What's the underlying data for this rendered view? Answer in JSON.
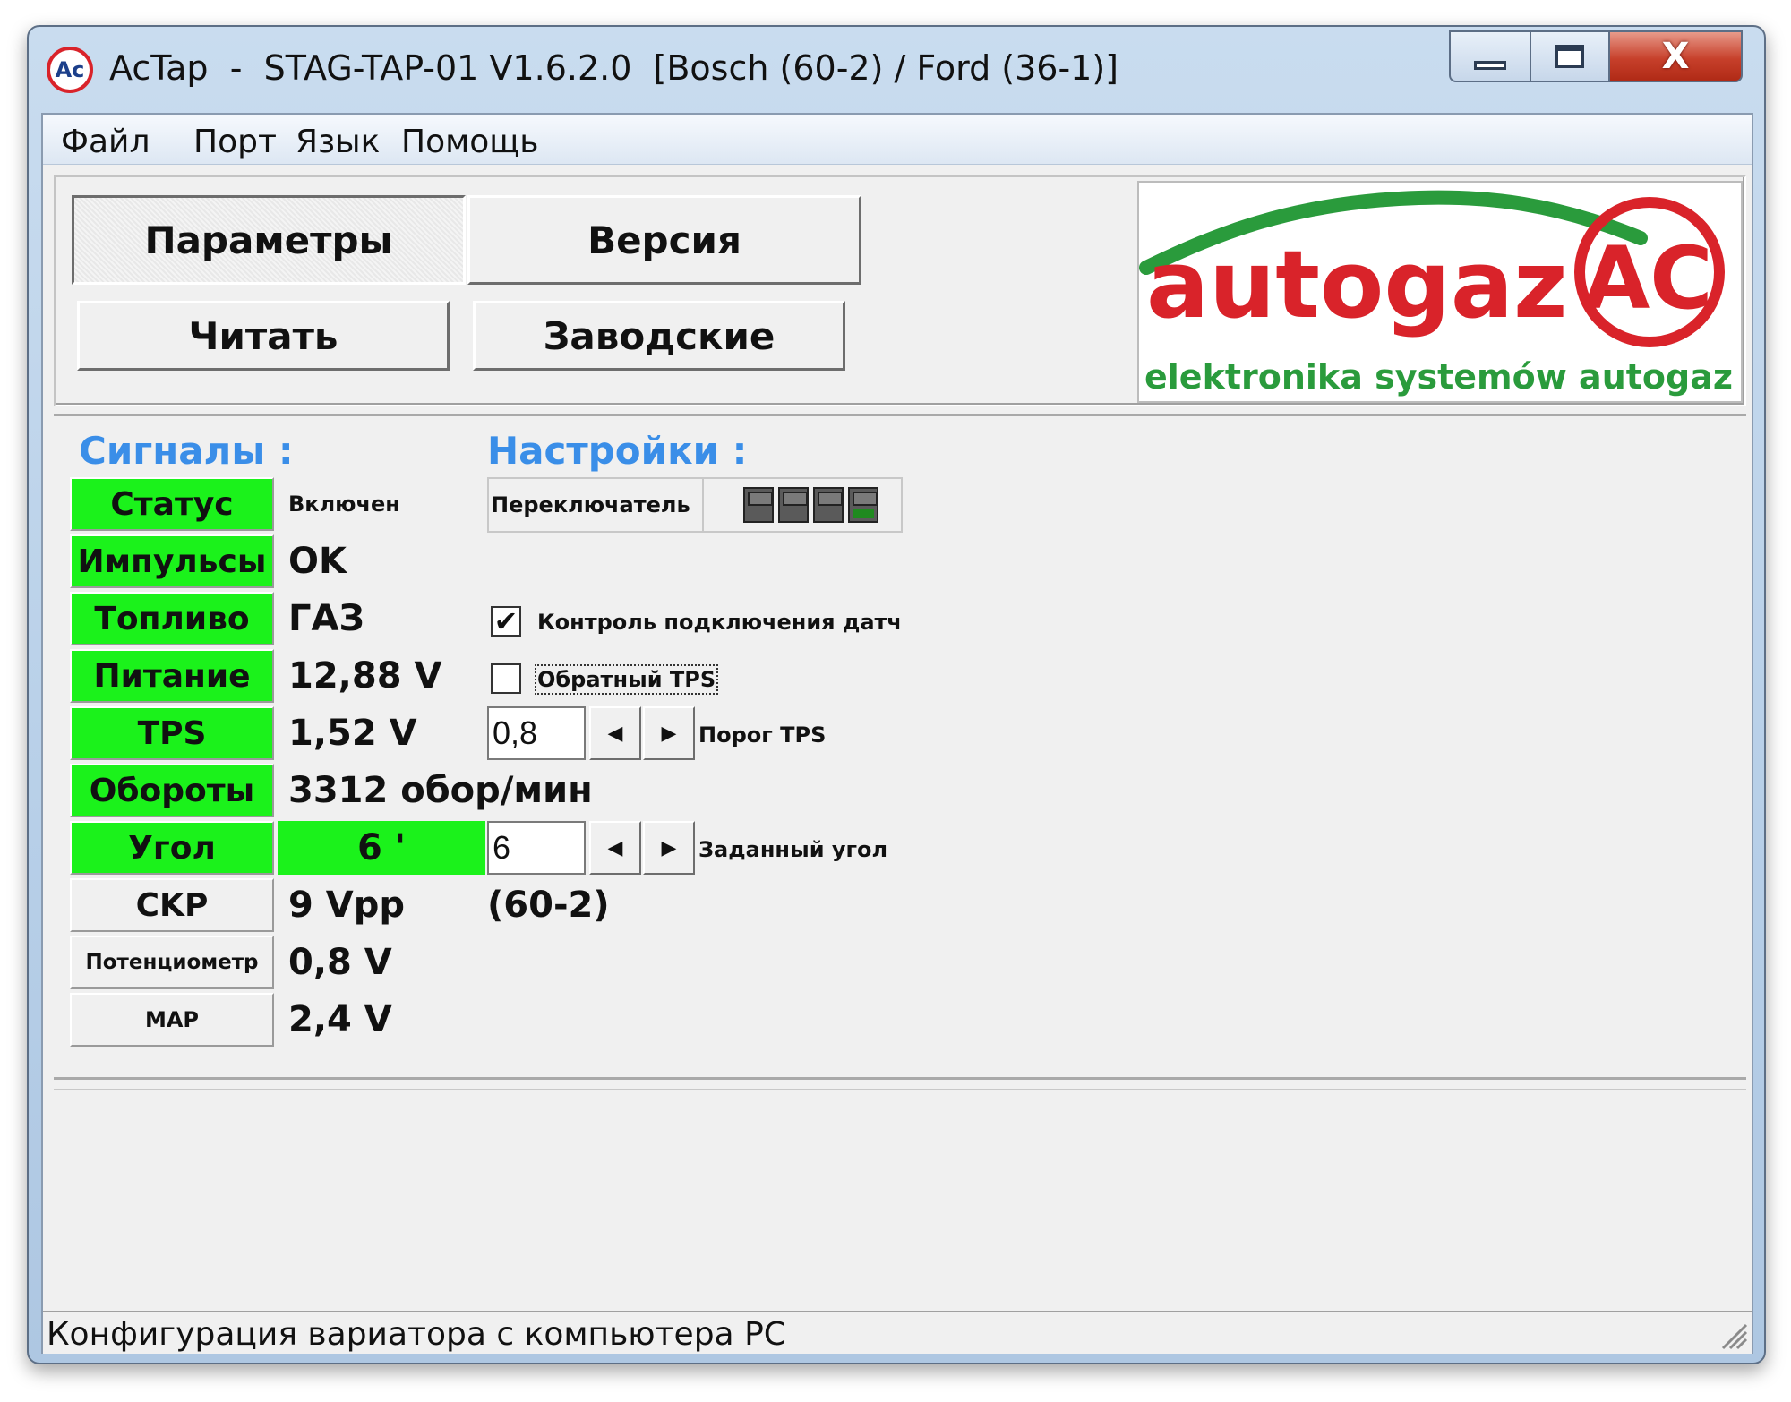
{
  "window": {
    "title": "AcTap  -  STAG-TAP-01 V1.6.2.0  [Bosch (60-2) / Ford (36-1)]",
    "icon_text": "Ac",
    "close_glyph": "X"
  },
  "menu": [
    "Файл",
    "Порт",
    "Язык",
    "Помощь"
  ],
  "toolbar": {
    "params": "Параметры",
    "version": "Версия",
    "read": "Читать",
    "factory": "Заводские"
  },
  "logo": {
    "brand": "autogaz",
    "mark": "AC",
    "tagline": "elektronika systemów autogaz"
  },
  "signals": {
    "title": "Сигналы :",
    "rows": [
      {
        "label": "Статус",
        "value": "Включен",
        "state": "ok"
      },
      {
        "label": "Импульсы",
        "value": "OK",
        "state": "ok"
      },
      {
        "label": "Топливо",
        "value": "ГАЗ",
        "state": "ok"
      },
      {
        "label": "Питание",
        "value": "12,88 V",
        "state": "ok"
      },
      {
        "label": "TPS",
        "value": "1,52 V",
        "state": "ok"
      },
      {
        "label": "Обороты",
        "value": "3312 обор/мин",
        "state": "ok"
      },
      {
        "label": "Угол",
        "value": "6 '",
        "state": "ok"
      },
      {
        "label": "CKP",
        "value": "9 Vpp",
        "state": "neutral"
      },
      {
        "label": "Потенциометр",
        "value": "0,8 V",
        "state": "neutral"
      },
      {
        "label": "MAP",
        "value": "2,4 V",
        "state": "neutral"
      }
    ]
  },
  "settings": {
    "title": "Настройки :",
    "switch_label": "Переключатель",
    "switch_positions": [
      false,
      false,
      false,
      true
    ],
    "sensor_check_label": "Контроль подключения датч",
    "sensor_check": true,
    "reverse_tps_label": "Обратный TPS",
    "reverse_tps": false,
    "tps_threshold_value": "0,8",
    "tps_threshold_label": "Порог TPS",
    "angle_value": "6",
    "angle_label": "Заданный угол",
    "ckp_type": "(60-2)",
    "arrow_left": "◀",
    "arrow_right": "▶",
    "check_mark": "✔"
  },
  "status_bar": "Конфигурация вариатора с компьютера PC",
  "colors": {
    "ok_green": "#1bf21b",
    "section_blue": "#3a8ee8",
    "logo_green": "#2a9b3c",
    "logo_red": "#d9232a"
  }
}
